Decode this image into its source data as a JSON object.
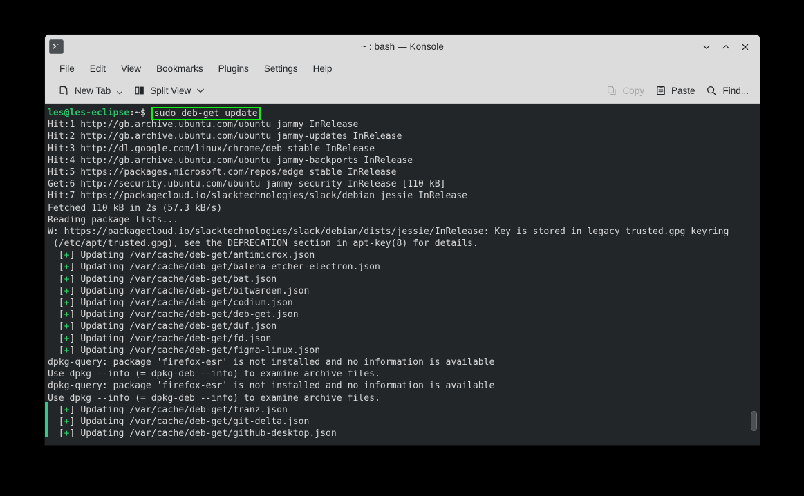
{
  "window": {
    "title": "~ : bash — Konsole",
    "app_icon": "konsole-terminal-icon",
    "controls": {
      "minimize": "minimize-icon",
      "maximize": "maximize-icon",
      "close": "close-icon"
    }
  },
  "menubar": {
    "items": [
      {
        "label": "File"
      },
      {
        "label": "Edit"
      },
      {
        "label": "View"
      },
      {
        "label": "Bookmarks"
      },
      {
        "label": "Plugins"
      },
      {
        "label": "Settings"
      },
      {
        "label": "Help"
      }
    ]
  },
  "toolbar": {
    "left": [
      {
        "label": "New Tab",
        "icon": "new-tab-icon",
        "has_menu": true,
        "enabled": true
      },
      {
        "label": "Split View",
        "icon": "split-view-icon",
        "has_menu": true,
        "enabled": true
      }
    ],
    "right": [
      {
        "label": "Copy",
        "icon": "copy-icon",
        "enabled": false
      },
      {
        "label": "Paste",
        "icon": "paste-icon",
        "enabled": true
      },
      {
        "label": "Find...",
        "icon": "search-icon",
        "enabled": true
      }
    ]
  },
  "terminal": {
    "colors": {
      "background": "#232629",
      "foreground": "#d6d6d6",
      "prompt_green": "#25c46b",
      "highlight_box": "#0df20d",
      "plus_green": "#2fcf6a",
      "edge_mark": "#34c98a"
    },
    "prompt": {
      "user_host": "les@les-eclipse",
      "path_sigil": ":~$",
      "command": "sudo deb-get update"
    },
    "lines": [
      "Hit:1 http://gb.archive.ubuntu.com/ubuntu jammy InRelease",
      "Hit:2 http://gb.archive.ubuntu.com/ubuntu jammy-updates InRelease",
      "Hit:3 http://dl.google.com/linux/chrome/deb stable InRelease",
      "Hit:4 http://gb.archive.ubuntu.com/ubuntu jammy-backports InRelease",
      "Hit:5 https://packages.microsoft.com/repos/edge stable InRelease",
      "Get:6 http://security.ubuntu.com/ubuntu jammy-security InRelease [110 kB]",
      "Hit:7 https://packagecloud.io/slacktechnologies/slack/debian jessie InRelease",
      "Fetched 110 kB in 2s (57.3 kB/s)",
      "Reading package lists...",
      "W: https://packagecloud.io/slacktechnologies/slack/debian/dists/jessie/InRelease: Key is stored in legacy trusted.gpg keyring",
      " (/etc/apt/trusted.gpg), see the DEPRECATION section in apt-key(8) for details."
    ],
    "updating_block_1": [
      "  [+] Updating /var/cache/deb-get/antimicrox.json",
      "  [+] Updating /var/cache/deb-get/balena-etcher-electron.json",
      "  [+] Updating /var/cache/deb-get/bat.json",
      "  [+] Updating /var/cache/deb-get/bitwarden.json",
      "  [+] Updating /var/cache/deb-get/codium.json",
      "  [+] Updating /var/cache/deb-get/deb-get.json",
      "  [+] Updating /var/cache/deb-get/duf.json",
      "  [+] Updating /var/cache/deb-get/fd.json",
      "  [+] Updating /var/cache/deb-get/figma-linux.json"
    ],
    "dpkg_lines": [
      "dpkg-query: package 'firefox-esr' is not installed and no information is available",
      "Use dpkg --info (= dpkg-deb --info) to examine archive files.",
      "dpkg-query: package 'firefox-esr' is not installed and no information is available",
      "Use dpkg --info (= dpkg-deb --info) to examine archive files."
    ],
    "updating_block_2": [
      "  [+] Updating /var/cache/deb-get/franz.json",
      "  [+] Updating /var/cache/deb-get/git-delta.json",
      "  [+] Updating /var/cache/deb-get/github-desktop.json"
    ]
  }
}
